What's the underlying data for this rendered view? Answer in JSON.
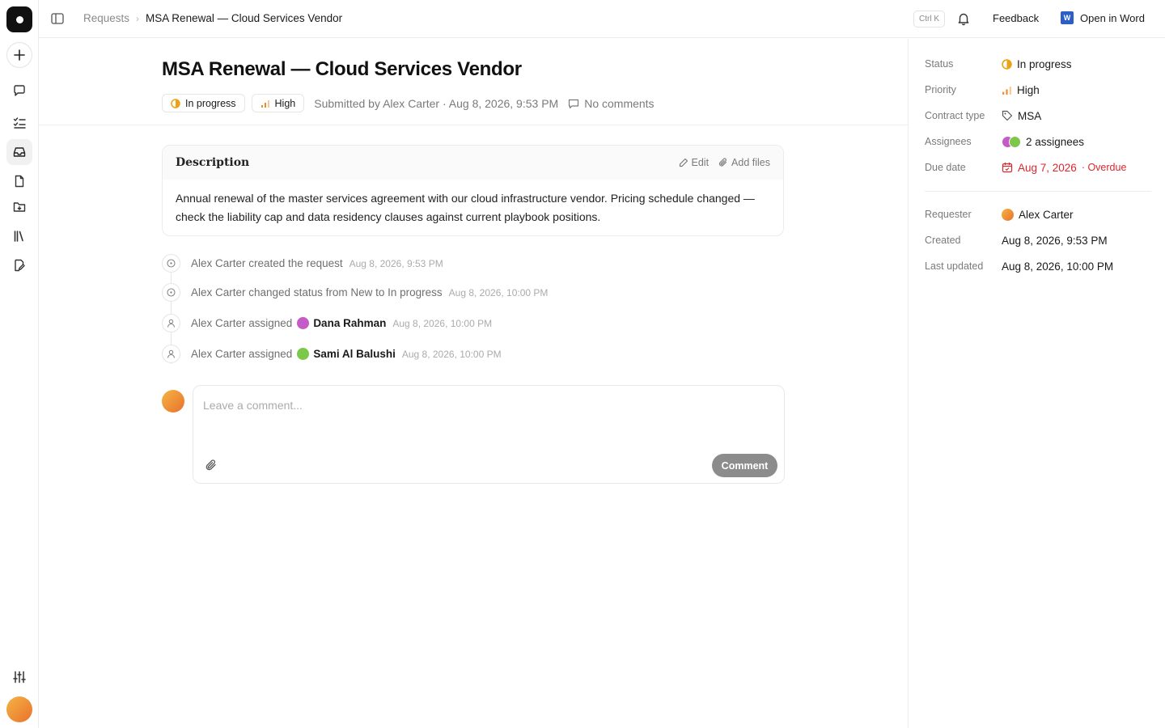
{
  "header": {
    "breadcrumb_parent": "Requests",
    "breadcrumb_current": "MSA Renewal — Cloud Services Vendor",
    "shortcut": "Ctrl K",
    "feedback_label": "Feedback",
    "open_in_word_label": "Open in Word"
  },
  "page": {
    "title": "MSA Renewal — Cloud Services Vendor",
    "status_pill": "In progress",
    "priority_pill": "High",
    "submitted_text": "Submitted by Alex Carter · Aug 8, 2026, 9:53 PM",
    "comments_text": "No comments"
  },
  "description": {
    "title": "Description",
    "edit_label": "Edit",
    "add_files_label": "Add files",
    "body": "Annual renewal of the master services agreement with our cloud infrastructure vendor. Pricing schedule changed — check the liability cap and data residency clauses against current playbook positions."
  },
  "activity": [
    {
      "text": "Alex Carter created the request",
      "time": "Aug 8, 2026, 9:53 PM"
    },
    {
      "text": "Alex Carter changed status from New to In progress",
      "time": "Aug 8, 2026, 10:00 PM"
    },
    {
      "text": "Alex Carter assigned",
      "user": "Dana Rahman",
      "time": "Aug 8, 2026, 10:00 PM"
    },
    {
      "text": "Alex Carter assigned",
      "user": "Sami Al Balushi",
      "time": "Aug 8, 2026, 10:00 PM"
    }
  ],
  "composer": {
    "placeholder": "Leave a comment...",
    "submit_label": "Comment"
  },
  "properties": {
    "status": {
      "label": "Status",
      "value": "In progress"
    },
    "priority": {
      "label": "Priority",
      "value": "High"
    },
    "contract_type": {
      "label": "Contract type",
      "value": "MSA"
    },
    "assignees": {
      "label": "Assignees",
      "value": "2 assignees"
    },
    "due_date": {
      "label": "Due date",
      "value": "Aug 7, 2026",
      "tag": "· Overdue"
    },
    "requester": {
      "label": "Requester",
      "value": "Alex Carter"
    },
    "created": {
      "label": "Created",
      "value": "Aug 8, 2026, 9:53 PM"
    },
    "last_updated": {
      "label": "Last updated",
      "value": "Aug 8, 2026, 10:00 PM"
    }
  },
  "colors": {
    "status_amber": "#e8a317",
    "priority_orange": "#f08a24",
    "overdue_red": "#d9272e",
    "avatar_dana": "#c55bc8",
    "avatar_sami": "#7cc84a",
    "word_blue": "#2b5fc7"
  },
  "icons": {
    "rail": [
      "app-logo-icon",
      "plus-icon",
      "chat-icon",
      "checklist-icon",
      "inbox-icon",
      "document-icon",
      "folder-icon",
      "library-icon",
      "edit-document-icon",
      "sliders-icon"
    ],
    "top": [
      "sidebar-toggle-icon",
      "bell-icon",
      "word-icon"
    ]
  }
}
